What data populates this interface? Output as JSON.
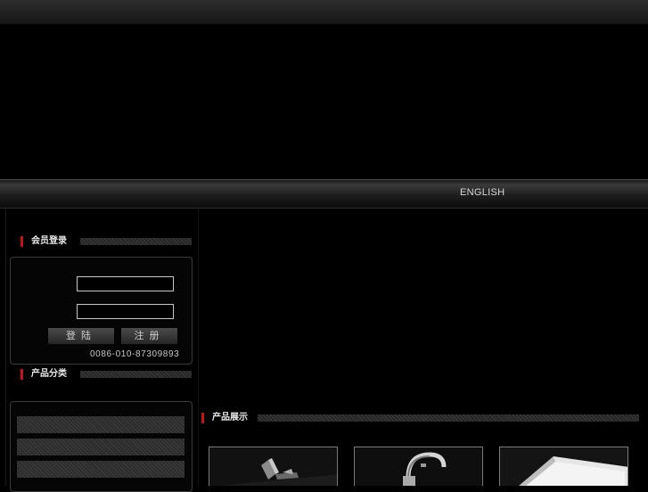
{
  "nav": {
    "language_link": "ENGLISH"
  },
  "member_login": {
    "title": "会员登录",
    "username_value": "",
    "password_value": "",
    "login_button": "登陆",
    "register_button": "注册",
    "phone": "0086-010-87309893"
  },
  "product_category": {
    "title": "产品分类",
    "items": [
      "",
      "",
      ""
    ]
  },
  "product_display": {
    "title": "产品展示",
    "thumbnails": [
      "faucet-image",
      "faucet-image",
      "basin-image"
    ]
  },
  "colors": {
    "accent_red": "#c2141b",
    "background": "#000000"
  }
}
